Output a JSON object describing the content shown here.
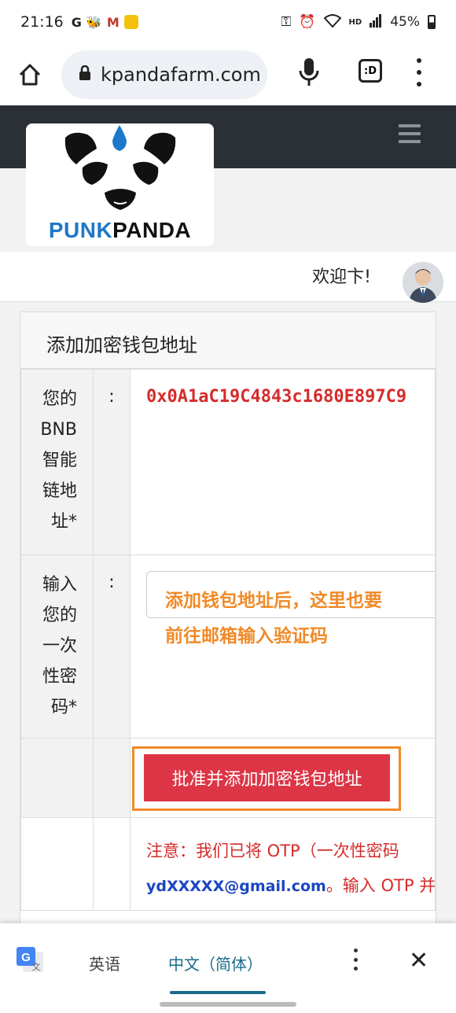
{
  "status_bar": {
    "time": "21:16",
    "left_icons": [
      "google-icon",
      "bee-icon",
      "app-m-icon",
      "app-yellow-icon"
    ],
    "right_icons": [
      "key-icon",
      "alarm-icon",
      "wifi-icon",
      "signal-icon",
      "battery-icon"
    ],
    "hd_label": "HD",
    "battery": "45%"
  },
  "browser": {
    "url": "kpandafarm.com",
    "tabs_label": ":D"
  },
  "site": {
    "logo_text_a": "PUNK",
    "logo_text_b": "PANDA",
    "welcome": "欢迎卞!"
  },
  "form": {
    "title": "添加加密钱包地址",
    "bnb_label": "您的\nBNB\n智能\n链地\n址*",
    "colon": ":",
    "bnb_address": "0x0A1aC19C4843c1680E897C9",
    "otp_label": "输入\n您的\n一次\n性密\n码*",
    "otp_value": "",
    "annotation_line1": "添加钱包地址后，这里也要",
    "annotation_line2": "前往邮箱输入验证码",
    "submit_label": "批准并添加加密钱包地址",
    "note_line1": "注意：我们已将 OTP（一次性密码",
    "note_email": "ydXXXXX@gmail.com",
    "note_line2_rest": "。输入 OTP 并继"
  },
  "translate_bar": {
    "source_lang": "英语",
    "target_lang": "中文（简体）"
  },
  "colors": {
    "header_dark": "#2b3036",
    "address_red": "#d62b2b",
    "button_red": "#dc3545",
    "annotation_orange": "#f08a28",
    "email_blue": "#1b46c2"
  }
}
